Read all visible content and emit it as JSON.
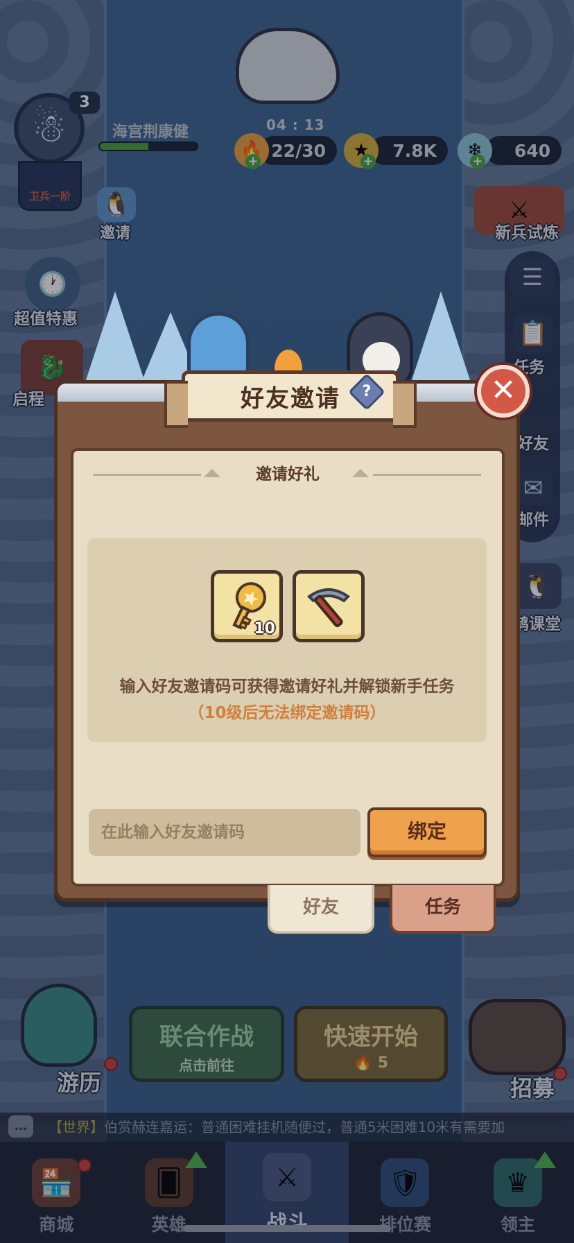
{
  "hud": {
    "player_level": "3",
    "player_name": "海宫荆康健",
    "rank_label": "卫兵一阶",
    "xp_progress": 0.5,
    "timer": "04 : 13",
    "stamina": "22/30",
    "gold": "7.8K",
    "gems": "640"
  },
  "left_menu": {
    "invite": "邀请",
    "special_offer": "超值特惠",
    "journey": "启程"
  },
  "right_menu": {
    "new_recruit_trial": "新兵试炼",
    "tasks": "任务",
    "friends": "好友",
    "mail": "邮件",
    "classroom": "鹊课堂"
  },
  "modal": {
    "title": "好友邀请",
    "help_glyph": "?",
    "close_glyph": "✕",
    "section_heading": "邀请好礼",
    "rewards": [
      {
        "icon": "golden-key-icon",
        "count": "10"
      },
      {
        "icon": "pickaxe-icon",
        "count": ""
      }
    ],
    "description": "输入好友邀请码可获得邀请好礼并解锁新手任务",
    "notice": "（10级后无法绑定邀请码）",
    "input_placeholder": "在此输入好友邀请码",
    "bind_label": "绑定",
    "tabs": {
      "friends": "好友",
      "tasks": "任务"
    }
  },
  "bottom_actions": {
    "explore": "游历",
    "coop_title": "联合作战",
    "coop_sub": "点击前往",
    "quick_start": "快速开始",
    "quick_start_cost": "5",
    "recruit": "招募"
  },
  "chat": {
    "channel": "【世界】",
    "message": "伯赏赫连嘉运：普通困难挂机随便过，普通5米困难10米有需要加"
  },
  "nav": [
    {
      "label": "商城",
      "icon": "shop-icon"
    },
    {
      "label": "英雄",
      "icon": "hero-card-icon"
    },
    {
      "label": "战斗",
      "icon": "crossed-swords-icon"
    },
    {
      "label": "排位赛",
      "icon": "ranking-shield-icon"
    },
    {
      "label": "领主",
      "icon": "lord-banner-icon"
    }
  ],
  "colors": {
    "modal_frame": "#7d5640",
    "panel_bg": "#e9dec5",
    "bind_button": "#f0a14c",
    "notice_text": "#cf7f3d",
    "close_button": "#d35846"
  }
}
